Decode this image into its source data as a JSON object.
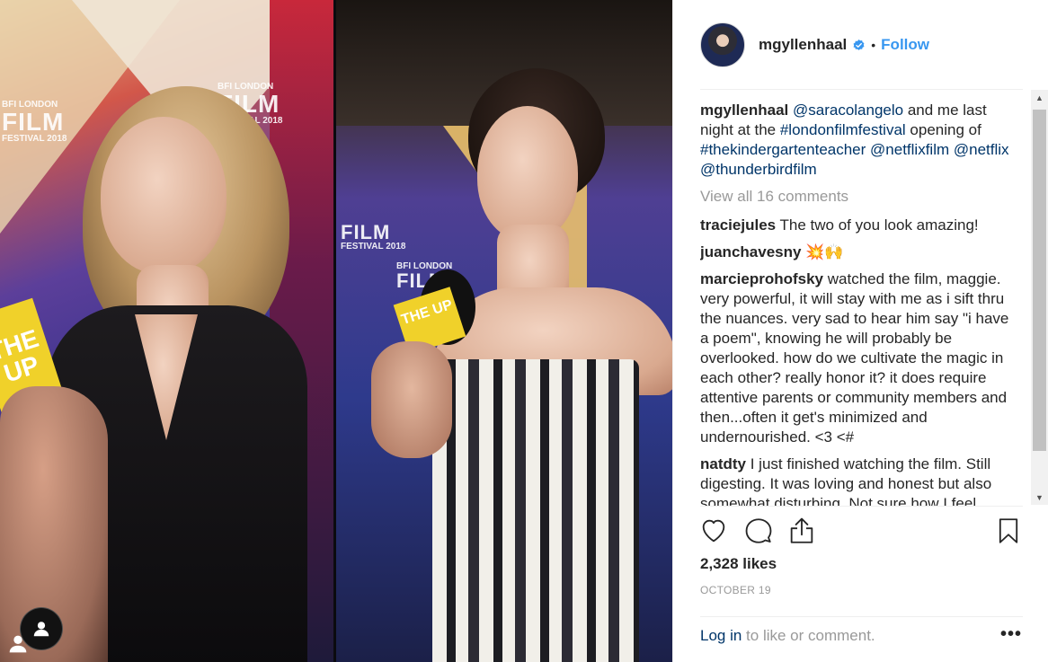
{
  "photo": {
    "left_logo": {
      "line1": "BFI LONDON",
      "line2": "FILM",
      "line3": "FESTIVAL 2018"
    },
    "right_logo": {
      "line1": "BFI LONDON",
      "line2": "FILM",
      "line3": "FESTIVAL 2018"
    },
    "mic_flag_text": "THE UP"
  },
  "header": {
    "username": "mgyllenhaal",
    "verified_icon": "verified-badge-icon",
    "separator": "•",
    "follow_label": "Follow"
  },
  "caption": {
    "username": "mgyllenhaal",
    "mention1": "@saracolangelo",
    "text1": " and me last night at the ",
    "hashtag1": "#londonfilmfestival",
    "text2": " opening of ",
    "hashtag2": "#thekindergartenteacher",
    "text3": " ",
    "mention2": "@netflixfilm",
    "text4": " ",
    "mention3": "@netflix",
    "text5": " ",
    "mention4": "@thunderbirdfilm"
  },
  "view_all_comments": "View all 16 comments",
  "comments": [
    {
      "username": "traciejules",
      "text": "The two of you look amazing!"
    },
    {
      "username": "juanchavesny",
      "text": "💥🙌"
    },
    {
      "username": "marcieprohofsky",
      "text": "watched the film, maggie. very powerful, it will stay with me as i sift thru the nuances. very sad to hear him say \"i have a poem\", knowing he will probably be overlooked. how do we cultivate the magic in each other? really honor it? it does require attentive parents or community members and then...often it get's minimized and undernourished. <3 <#"
    },
    {
      "username": "natdty",
      "text": "I just finished watching the film. Still digesting. It was loving and honest but also somewhat disturbing. Not sure how I feel"
    }
  ],
  "actions": {
    "like_icon": "heart-icon",
    "comment_icon": "comment-icon",
    "share_icon": "share-icon",
    "save_icon": "bookmark-icon"
  },
  "likes": "2,328 likes",
  "date": "OCTOBER 19",
  "footer": {
    "login_label": "Log in",
    "rest_text": " to like or comment.",
    "more_label": "•••"
  },
  "colors": {
    "accent": "#3897f0",
    "link": "#003569",
    "muted": "#999999",
    "text": "#262626"
  }
}
